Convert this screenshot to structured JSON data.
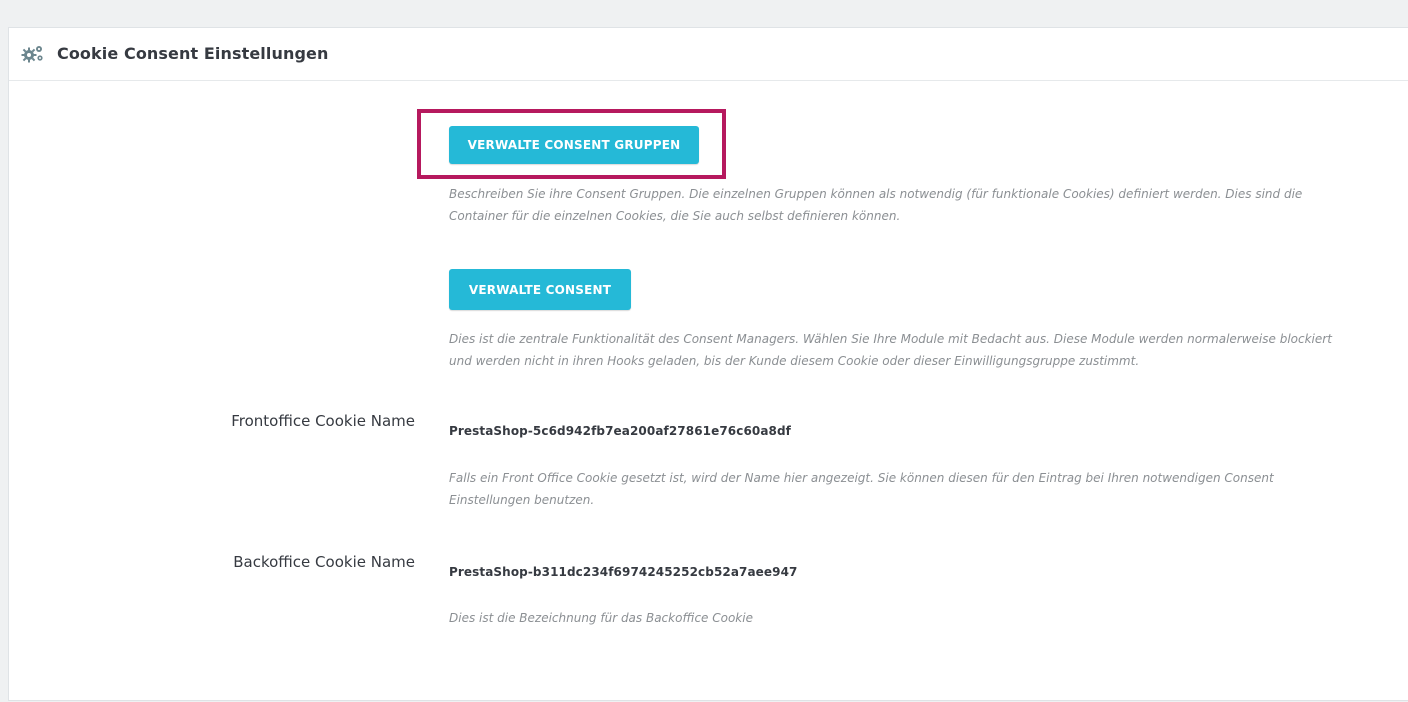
{
  "panel": {
    "title": "Cookie Consent Einstellungen",
    "icon": "cogs-icon"
  },
  "consent_groups": {
    "button_label": "VERWALTE CONSENT GRUPPEN",
    "help": "Beschreiben Sie ihre Consent Gruppen. Die einzelnen Gruppen können als notwendig (für funktionale Cookies) definiert werden. Dies sind die Container für die einzelnen Cookies, die Sie auch selbst definieren können."
  },
  "consent": {
    "button_label": "VERWALTE CONSENT",
    "help": "Dies ist die zentrale Funktionalität des Consent Managers. Wählen Sie Ihre Module mit Bedacht aus. Diese Module werden normalerweise blockiert und werden nicht in ihren Hooks geladen, bis der Kunde diesem Cookie oder dieser Einwilligungsgruppe zustimmt."
  },
  "frontoffice": {
    "label": "Frontoffice Cookie Name",
    "value": "PrestaShop-5c6d942fb7ea200af27861e76c60a8df",
    "help": "Falls ein Front Office Cookie gesetzt ist, wird der Name hier angezeigt. Sie können diesen für den Eintrag bei Ihren notwendigen Consent Einstellungen benutzen."
  },
  "backoffice": {
    "label": "Backoffice Cookie Name",
    "value": "PrestaShop-b311dc234f6974245252cb52a7aee947",
    "help": "Dies ist die Bezeichnung für das Backoffice Cookie"
  },
  "colors": {
    "button": "#25b9d7",
    "highlight": "#b6195e",
    "help_text": "#8b8f93"
  }
}
